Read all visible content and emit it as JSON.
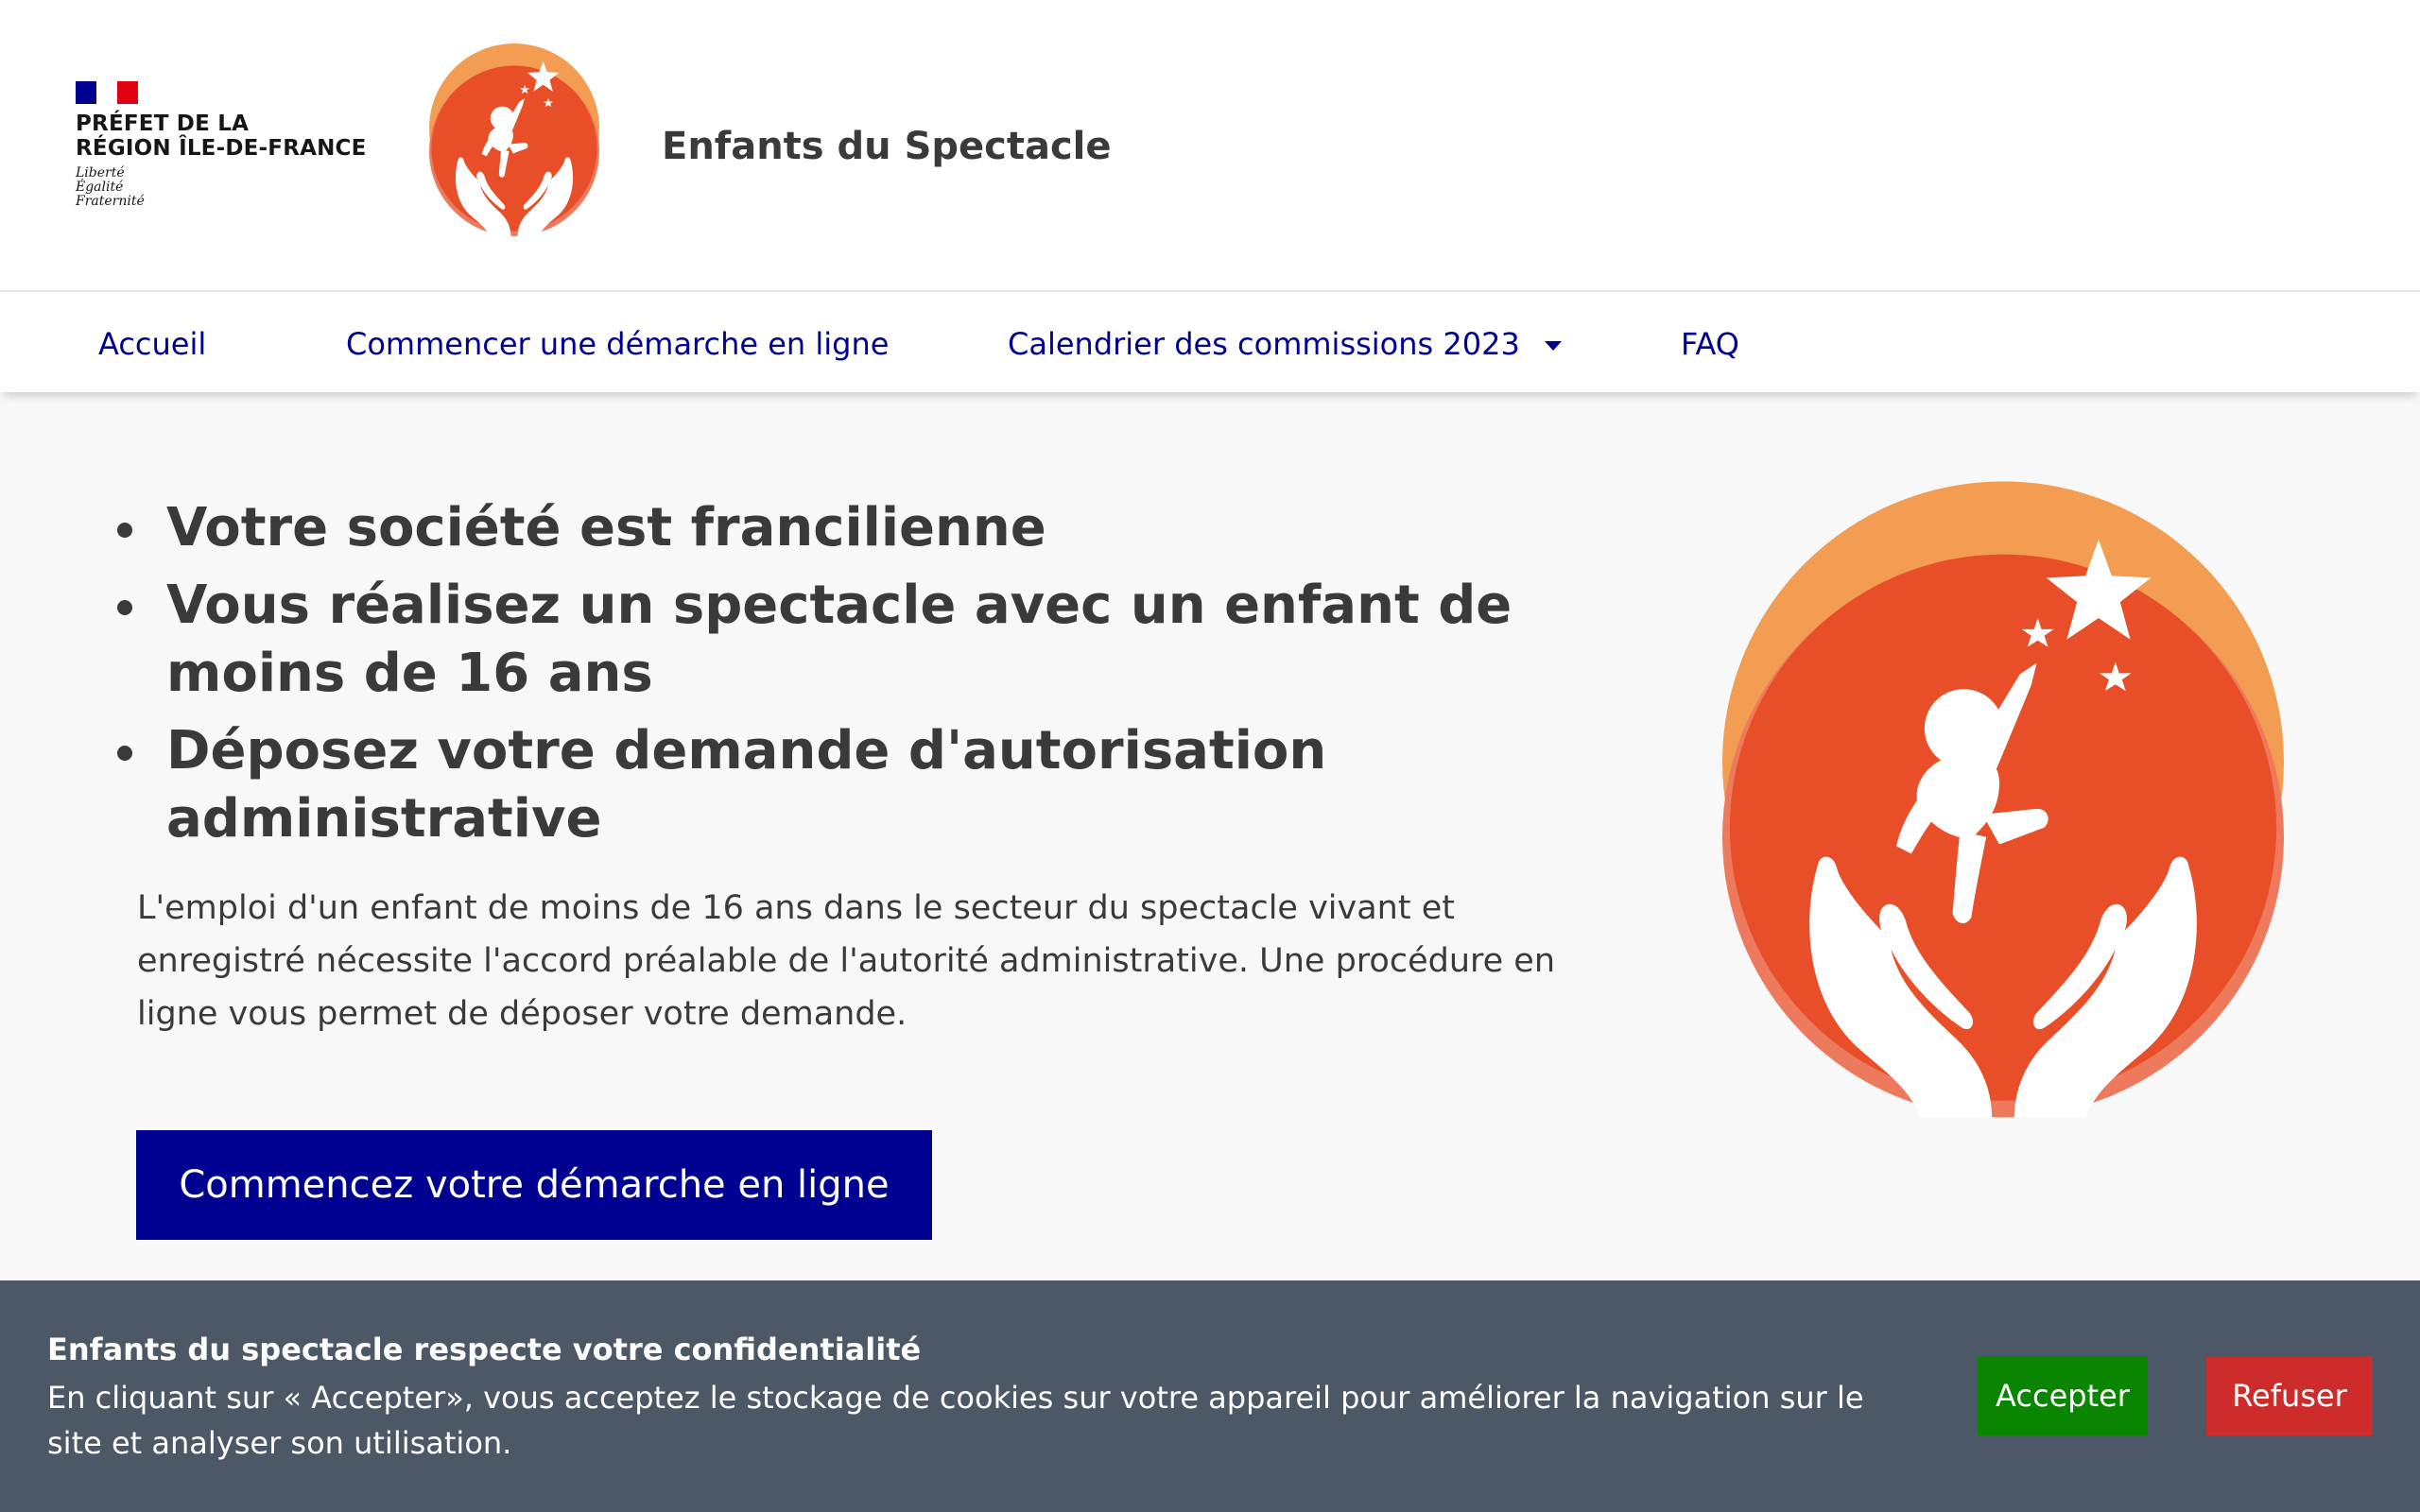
{
  "header": {
    "prefet_line1": "PRÉFET DE LA",
    "prefet_line2": "RÉGION ÎLE-DE-FRANCE",
    "devise": [
      "Liberté",
      "Égalité",
      "Fraternité"
    ],
    "site_title": "Enfants du Spectacle"
  },
  "nav": {
    "items": [
      {
        "label": "Accueil"
      },
      {
        "label": "Commencer une démarche en ligne"
      },
      {
        "label": "Calendrier des commissions 2023"
      },
      {
        "label": "FAQ"
      }
    ]
  },
  "hero": {
    "bullets": [
      "Votre société est francilienne",
      "Vous réalisez un spectacle avec un enfant de moins de 16 ans",
      "Déposez votre demande d'autorisation administrative"
    ],
    "intro": "L'emploi d'un enfant de moins de 16 ans dans le secteur du spectacle vivant et enregistré nécessite l'accord préalable de l'autorité administrative. Une procédure en ligne vous permet de déposer votre demande.",
    "cta_label": "Commencez votre démarche en ligne"
  },
  "cookie": {
    "title": "Enfants du spectacle respecte votre confidentialité",
    "text": "En cliquant sur « Accepter», vous acceptez le stockage de cookies sur votre appareil pour améliorer la navigation sur le site et analyser son utilisation.",
    "accept_label": "Accepter",
    "refuse_label": "Refuser"
  },
  "colors": {
    "primary_blue": "#000091",
    "logo_orange_light": "#f29d52",
    "logo_orange": "#e84e28",
    "logo_orange_pink": "#ee7a5e",
    "cookie_bg": "#4c5865",
    "accept_green": "#0a8500",
    "refuse_red": "#ce2b2b"
  }
}
